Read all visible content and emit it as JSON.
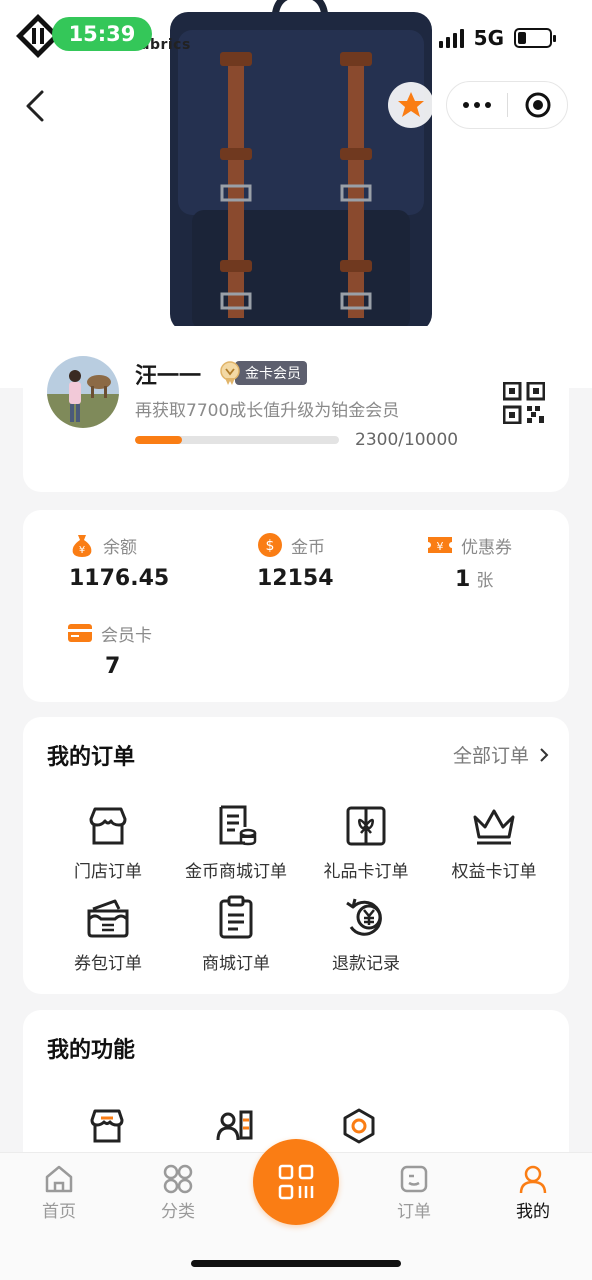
{
  "status_bar": {
    "time": "15:39",
    "network": "5G"
  },
  "brand": {
    "partial_text": "abrics"
  },
  "member": {
    "name": "汪一一",
    "tier": "金卡会员",
    "upgrade_tip": "再获取7700成长值升级为铂金会员",
    "growth_current": 2300,
    "growth_target": 10000,
    "progress_text": "2300/10000",
    "progress_fraction": 0.23
  },
  "assets": {
    "balance": {
      "label": "余额",
      "value": "1176.45",
      "icon": "money-bag-icon"
    },
    "coins": {
      "label": "金币",
      "value": "12154",
      "icon": "dollar-coin-icon"
    },
    "coupons": {
      "label": "优惠券",
      "value": "1",
      "unit": "张",
      "icon": "yen-ticket-icon"
    },
    "member_cards": {
      "label": "会员卡",
      "value": "7",
      "icon": "credit-card-icon"
    }
  },
  "orders": {
    "title": "我的订单",
    "all_label": "全部订单",
    "items": [
      {
        "label": "门店订单",
        "icon": "store-icon"
      },
      {
        "label": "金币商城订单",
        "icon": "receipt-coins-icon"
      },
      {
        "label": "礼品卡订单",
        "icon": "gift-card-icon"
      },
      {
        "label": "权益卡订单",
        "icon": "crown-icon"
      },
      {
        "label": "券包订单",
        "icon": "wallet-icon"
      },
      {
        "label": "商城订单",
        "icon": "clipboard-icon"
      },
      {
        "label": "退款记录",
        "icon": "refund-yen-icon"
      }
    ]
  },
  "functions": {
    "title": "我的功能",
    "icons": [
      "store-icon",
      "contacts-icon",
      "hexagon-settings-icon"
    ]
  },
  "tabbar": {
    "items": [
      {
        "label": "首页",
        "icon": "home-icon",
        "active": false
      },
      {
        "label": "分类",
        "icon": "category-icon",
        "active": false
      },
      {
        "label": "",
        "icon": "scan-icon",
        "active": false
      },
      {
        "label": "订单",
        "icon": "order-icon",
        "active": false
      },
      {
        "label": "我的",
        "icon": "user-icon",
        "active": true
      }
    ]
  },
  "colors": {
    "accent": "#fa7d14",
    "badge_bg": "#5d5f6e",
    "status_green": "#34c759"
  }
}
